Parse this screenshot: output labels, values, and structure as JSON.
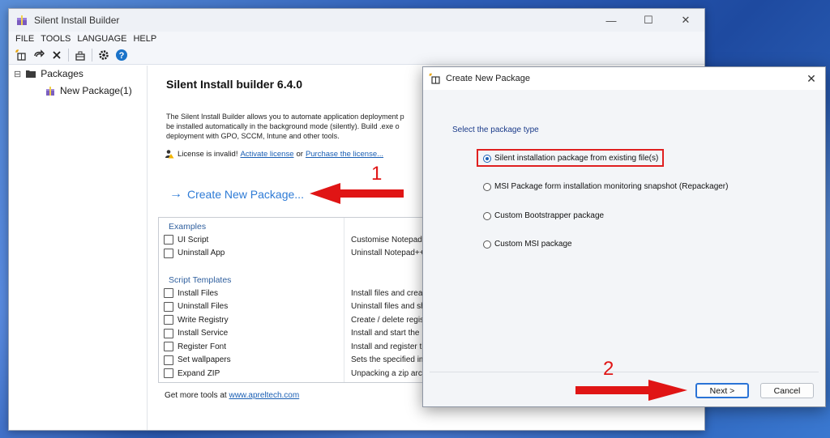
{
  "main_window": {
    "title": "Silent Install Builder",
    "controls": {
      "minimize": "—",
      "maximize": "☐",
      "close": "✕"
    },
    "menu": [
      "FILE",
      "TOOLS",
      "LANGUAGE",
      "HELP"
    ]
  },
  "tree": {
    "root_label": "Packages",
    "expander": "⊟",
    "child_label": "New Package(1)"
  },
  "content": {
    "heading": "Silent Install builder 6.4.0",
    "description_lines": [
      "The Silent Install Builder allows you to automate application deployment p",
      "be installed automatically in the background mode (silently).  Build .exe o",
      "deployment with GPO, SCCM, Intune and other tools."
    ],
    "license_prefix": "License is invalid!",
    "activate_link": "Activate license",
    "license_or": "or",
    "purchase_link": "Purchase the license...",
    "create_link": "Create New Package...",
    "create_arrow": "→",
    "examples_group": "Examples",
    "examples": [
      {
        "name": "UI Script",
        "desc": "Customise Notepad+"
      },
      {
        "name": "Uninstall App",
        "desc": "Uninstall Notepad++"
      }
    ],
    "templates_group": "Script Templates",
    "templates": [
      {
        "name": "Install Files",
        "desc": "Install files and creat"
      },
      {
        "name": "Uninstall Files",
        "desc": "Uninstall files and sho"
      },
      {
        "name": "Write Registry",
        "desc": "Create / delete regis"
      },
      {
        "name": "Install Service",
        "desc": "Install and start the"
      },
      {
        "name": "Register Font",
        "desc": "Install and register th"
      },
      {
        "name": "Set wallpapers",
        "desc": "Sets the specified im"
      },
      {
        "name": "Expand ZIP",
        "desc": "Unpacking a zip archi"
      }
    ],
    "more_tools_prefix": "Get more tools at",
    "more_tools_link": "www.apreltech.com"
  },
  "dialog": {
    "title": "Create New Package",
    "close": "✕",
    "prompt": "Select the package type",
    "options": [
      {
        "label": "Silent installation package from existing file(s)",
        "selected": true
      },
      {
        "label": "MSI Package form installation monitoring snapshot (Repackager)",
        "selected": false
      },
      {
        "label": "Custom Bootstrapper package",
        "selected": false
      },
      {
        "label": "Custom MSI package",
        "selected": false
      }
    ],
    "next_label": "Next >",
    "cancel_label": "Cancel"
  },
  "annotations": {
    "step1": "1",
    "step2": "2",
    "color": "#e01515"
  }
}
